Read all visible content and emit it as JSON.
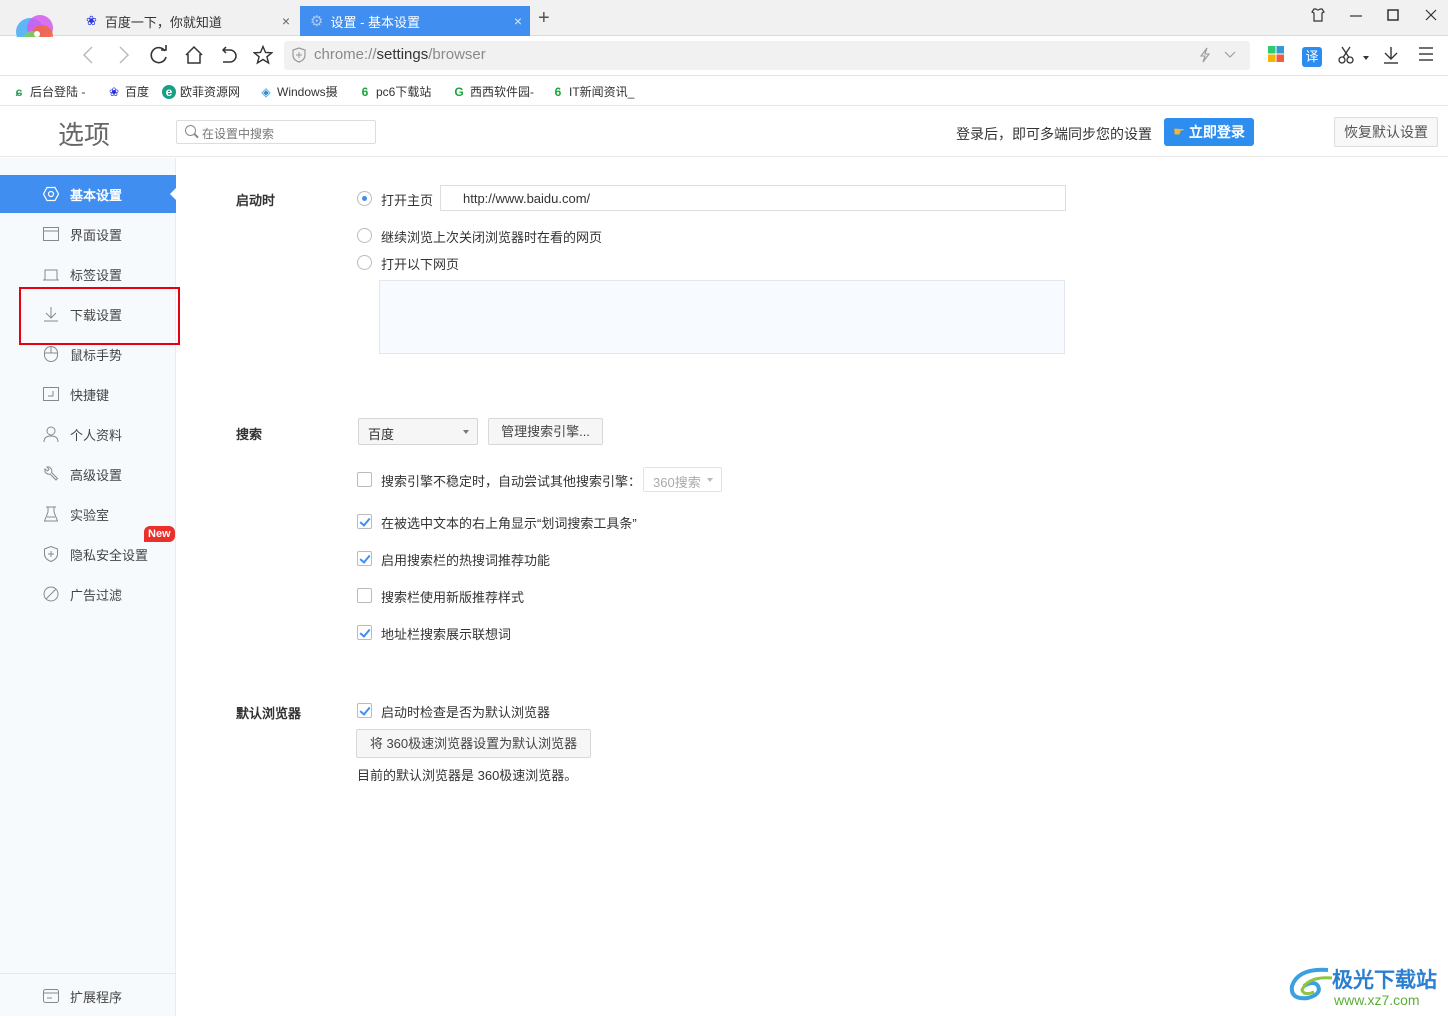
{
  "browser": {
    "login_badge": "立即登录",
    "tabs": [
      {
        "title": "百度一下，你就知道",
        "icon": "baidu-paw-icon",
        "active": false
      },
      {
        "title": "设置 - 基本设置",
        "icon": "gear-icon",
        "active": true
      }
    ],
    "new_tab_label": "+",
    "address": {
      "scheme": "chrome://",
      "host": "settings",
      "path": "/browser"
    },
    "bookmarks": [
      {
        "label": "后台登陆 -",
        "icon": "leaf-logo-icon"
      },
      {
        "label": "百度",
        "icon": "baidu-paw-icon"
      },
      {
        "label": "欧菲资源网",
        "icon": "ofei-logo-icon"
      },
      {
        "label": "Windows摄",
        "icon": "windows-site-icon"
      },
      {
        "label": "pc6下载站",
        "icon": "pc6-logo-icon"
      },
      {
        "label": "西西软件园-",
        "icon": "cc-logo-icon"
      },
      {
        "label": "IT新闻资讯_",
        "icon": "pc6-logo-icon"
      }
    ]
  },
  "header": {
    "title": "选项",
    "search_placeholder": "在设置中搜索",
    "sync_text": "登录后，即可多端同步您的设置",
    "login_button": "立即登录",
    "restore_button": "恢复默认设置"
  },
  "sidebar": {
    "items": [
      {
        "label": "基本设置",
        "icon": "hexagon-settings-icon",
        "active": true
      },
      {
        "label": "界面设置",
        "icon": "window-icon",
        "active": false
      },
      {
        "label": "标签设置",
        "icon": "tab-icon",
        "active": false
      },
      {
        "label": "下载设置",
        "icon": "download-icon",
        "active": false
      },
      {
        "label": "鼠标手势",
        "icon": "mouse-icon",
        "active": false
      },
      {
        "label": "快捷键",
        "icon": "keyboard-icon",
        "active": false
      },
      {
        "label": "个人资料",
        "icon": "user-icon",
        "active": false
      },
      {
        "label": "高级设置",
        "icon": "wrench-icon",
        "active": false
      },
      {
        "label": "实验室",
        "icon": "flask-icon",
        "active": false
      },
      {
        "label": "隐私安全设置",
        "icon": "shield-icon",
        "active": false
      },
      {
        "label": "广告过滤",
        "icon": "block-icon",
        "active": false
      }
    ],
    "new_badge": "New",
    "extensions": {
      "label": "扩展程序",
      "icon": "extension-icon"
    }
  },
  "startup": {
    "label": "启动时",
    "options": [
      {
        "label": "打开主页",
        "selected": true
      },
      {
        "label": "继续浏览上次关闭浏览器时在看的网页",
        "selected": false
      },
      {
        "label": "打开以下网页",
        "selected": false
      }
    ],
    "homepage_url": "http://www.baidu.com/"
  },
  "search": {
    "label": "搜索",
    "engine": "百度",
    "manage_button": "管理搜索引擎...",
    "fallback": {
      "label": "搜索引擎不稳定时，自动尝试其他搜索引擎：",
      "checked": false,
      "engine": "360搜索"
    },
    "options": [
      {
        "label": "在被选中文本的右上角显示“划词搜索工具条”",
        "checked": true
      },
      {
        "label": "启用搜索栏的热搜词推荐功能",
        "checked": true
      },
      {
        "label": "搜索栏使用新版推荐样式",
        "checked": false
      },
      {
        "label": "地址栏搜索展示联想词",
        "checked": true
      }
    ]
  },
  "default_browser": {
    "label": "默认浏览器",
    "check_label": "启动时检查是否为默认浏览器",
    "checked": true,
    "set_button": "将 360极速浏览器设置为默认浏览器",
    "status": "目前的默认浏览器是 360极速浏览器。"
  },
  "watermark": {
    "name": "极光下载站",
    "url": "www.xz7.com"
  },
  "colors": {
    "accent": "#3f8ef0",
    "highlight_box": "#e60012",
    "new_badge": "#e9302a"
  }
}
